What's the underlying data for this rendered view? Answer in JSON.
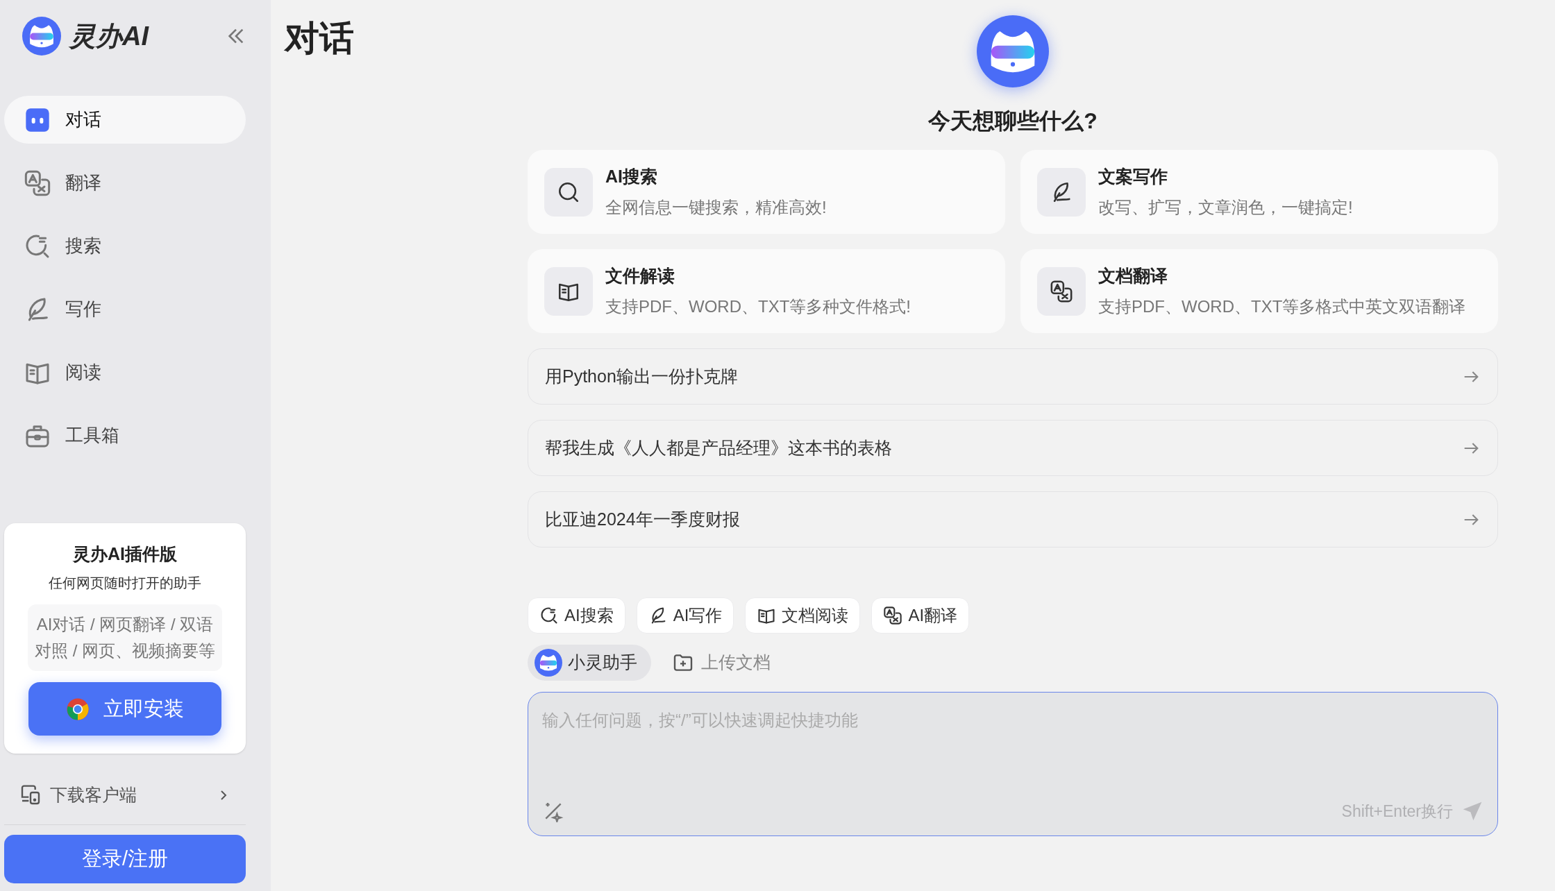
{
  "brand": {
    "name": "灵办AI"
  },
  "sidebar": {
    "items": [
      {
        "label": "对话",
        "kind": "chat",
        "selected": true
      },
      {
        "label": "翻译",
        "kind": "translate",
        "selected": false
      },
      {
        "label": "搜索",
        "kind": "search",
        "selected": false
      },
      {
        "label": "写作",
        "kind": "write",
        "selected": false
      },
      {
        "label": "阅读",
        "kind": "read",
        "selected": false
      },
      {
        "label": "工具箱",
        "kind": "toolbox",
        "selected": false
      }
    ]
  },
  "plugin_card": {
    "title": "灵办AI插件版",
    "subtitle": "任何网页随时打开的助手",
    "features": "AI对话 / 网页翻译 / 双语对照 / 网页、视频摘要等",
    "install_button": "立即安装"
  },
  "download_link": "下载客户端",
  "login_button": "登录/注册",
  "page_title": "对话",
  "greeting": "今天想聊些什么?",
  "feature_cards": [
    {
      "kind": "search",
      "title": "AI搜索",
      "description": "全网信息一键搜索，精准高效!"
    },
    {
      "kind": "write",
      "title": "文案写作",
      "description": "改写、扩写，文章润色，一键搞定!"
    },
    {
      "kind": "read",
      "title": "文件解读",
      "description": "支持PDF、WORD、TXT等多种文件格式!"
    },
    {
      "kind": "translate",
      "title": "文档翻译",
      "description": "支持PDF、WORD、TXT等多格式中英文双语翻译"
    }
  ],
  "suggestions": [
    "用Python输出一份扑克牌",
    "帮我生成《人人都是产品经理》这本书的表格",
    "比亚迪2024年一季度财报"
  ],
  "tool_chips": [
    {
      "kind": "search",
      "label": "AI搜索"
    },
    {
      "kind": "write",
      "label": "AI写作"
    },
    {
      "kind": "read",
      "label": "文档阅读"
    },
    {
      "kind": "translate",
      "label": "AI翻译"
    }
  ],
  "assistant_chip": {
    "label": "小灵助手",
    "selected": true
  },
  "upload_button": "上传文档",
  "input": {
    "placeholder": "输入任何问题，按“/”可以快速调起快捷功能",
    "hint": "Shift+Enter换行"
  }
}
